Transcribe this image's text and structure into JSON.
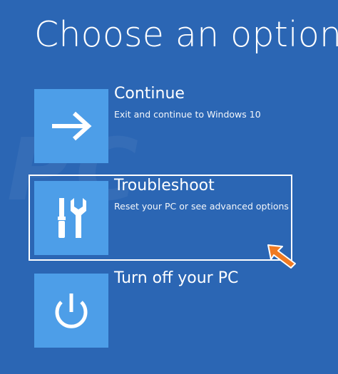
{
  "screen": {
    "title": "Choose an option"
  },
  "options": [
    {
      "label": "Continue",
      "description": "Exit and continue to Windows 10",
      "icon": "arrow-right-icon"
    },
    {
      "label": "Troubleshoot",
      "description": "Reset your PC or see advanced options",
      "icon": "tools-icon"
    },
    {
      "label": "Turn off your PC",
      "description": "",
      "icon": "power-icon"
    }
  ],
  "colors": {
    "background": "#2b66b4",
    "tile": "#4d9ee8",
    "pointer": "#f07a22"
  }
}
